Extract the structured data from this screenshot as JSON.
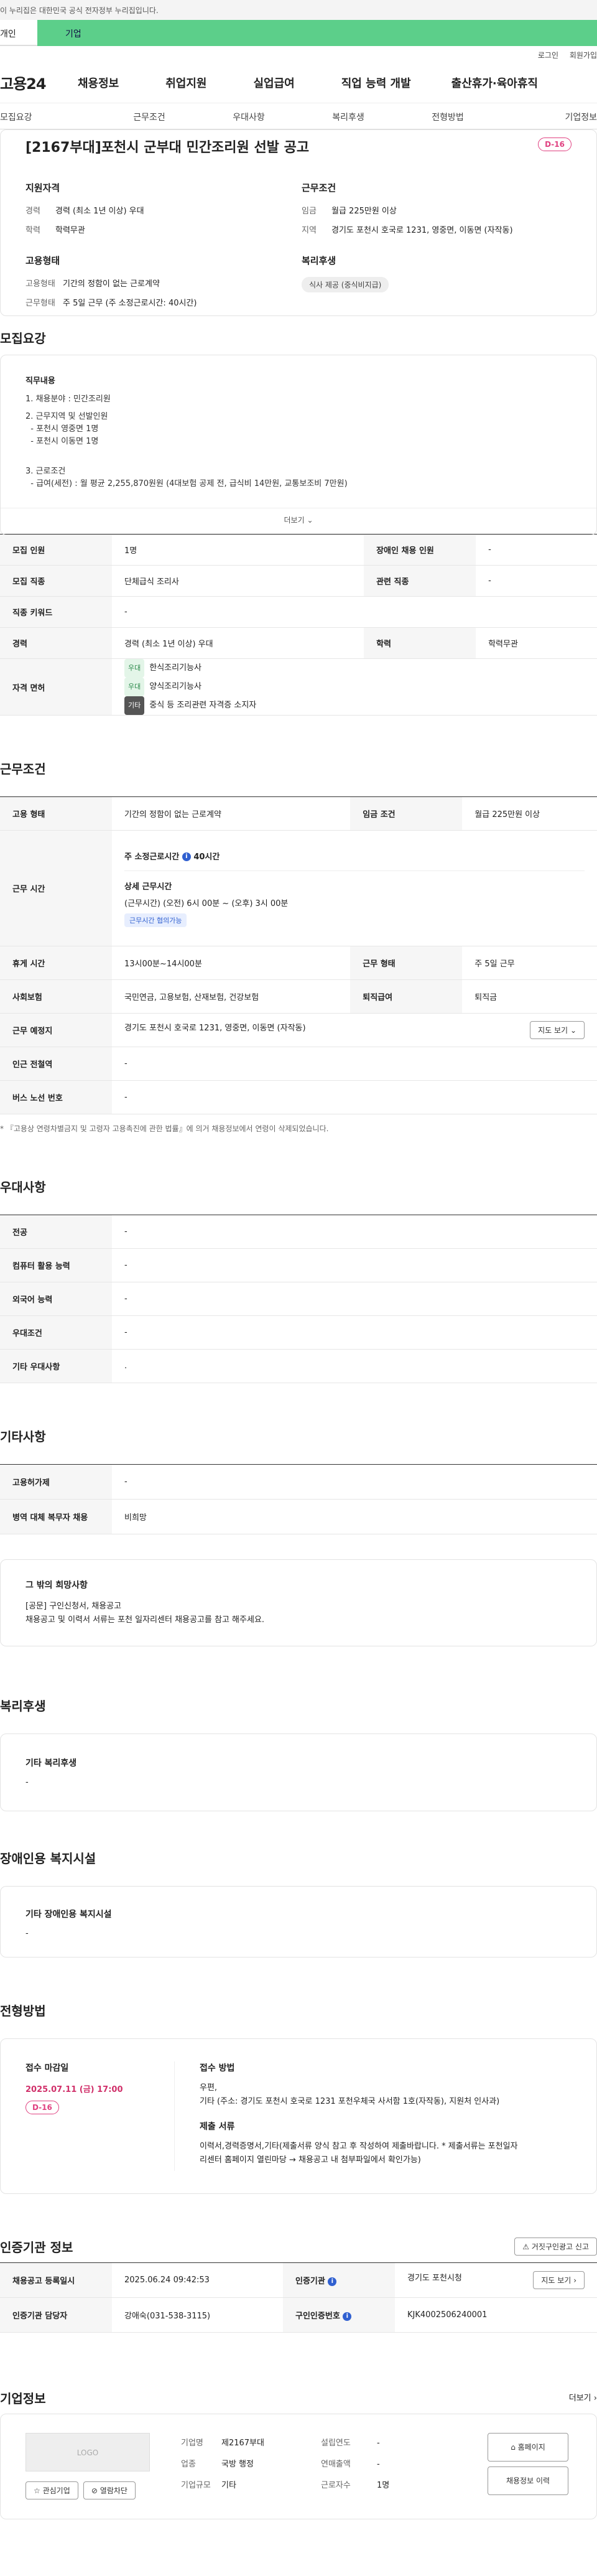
{
  "gov_banner": "이 누리집은 대한민국 공식 전자정부 누리집입니다.",
  "user_tabs": {
    "individual": "개인",
    "company": "기업"
  },
  "util_links": {
    "login": "로그인",
    "signup": "회원가입"
  },
  "logo": "고용24",
  "gnb": [
    "채용정보",
    "취업지원",
    "실업급여",
    "직업 능력 개발",
    "출산휴가·육아휴직"
  ],
  "subnav": [
    "모집요강",
    "근무조건",
    "우대사항",
    "복리후생",
    "전형방법",
    "기업정보"
  ],
  "title": {
    "heading": "[2167부대]포천시 군부대 민간조리원 선발 공고",
    "dday": "D-16",
    "qual_heading": "지원자격",
    "career_k": "경력",
    "career_v": "경력 (최소 1년 이상) 우대",
    "edu_k": "학력",
    "edu_v": "학력무관",
    "emp_heading": "고용형태",
    "emptype_k": "고용형태",
    "emptype_v": "기간의 정함이 없는 근로계약",
    "worktype_k": "근무형태",
    "worktype_v": "주 5일 근무 (주 소정근로시간: 40시간)",
    "cond_heading": "근무조건",
    "wage_k": "임금",
    "wage_v": "월급 225만원 이상",
    "area_k": "지역",
    "area_v": "경기도 포천시 호국로 1231, 영중면, 이동면 (자작동)",
    "welfare_heading": "복리후생",
    "welfare_pill": "식사 제공 (중식비지급)"
  },
  "recruit": {
    "heading": "모집요강",
    "duty_heading": "직무내용",
    "lines": [
      "1. 채용분야 : 민간조리원",
      "2. 근무지역 및 선발인원",
      "  - 포천시 영중면 1명",
      "  - 포천시 이동면 1명",
      "3. 근로조건",
      "  - 급여(세전) : 월 평균 2,255,870원원 (4대보험 공제 전, 급식비 14만원, 교통보조비 7만원)"
    ],
    "more": "더보기",
    "rows": {
      "count_k": "모집 인원",
      "count_v": "1명",
      "disabled_k": "장애인 채용 인원",
      "disabled_v": "-",
      "job_k": "모집 직종",
      "job_v": "단체급식 조리사",
      "related_k": "관련 직종",
      "related_v": "-",
      "keyword_k": "직종 키워드",
      "keyword_v": "-",
      "career_k": "경력",
      "career_v": "경력 (최소 1년 이상) 우대",
      "edu_k": "학력",
      "edu_v": "학력무관",
      "license_k": "자격 면허",
      "licenses": [
        {
          "tag": "우대",
          "name": "한식조리기능사"
        },
        {
          "tag": "우대",
          "name": "양식조리기능사"
        },
        {
          "tag": "기타",
          "name": "중식 등 조리관련 자격증 소지자"
        }
      ]
    }
  },
  "work": {
    "heading": "근무조건",
    "emp_k": "고용 형태",
    "emp_v": "기간의 정함이 없는 근로계약",
    "wage_k": "임금 조건",
    "wage_v": "월급 225만원 이상",
    "time_k": "근무 시간",
    "time_week": "주 소정근로시간",
    "time_hours": "40시간",
    "time_detail_h": "상세 근무시간",
    "time_detail_v": "(근무시간) (오전) 6시 00분 ~ (오후) 3시 00분",
    "time_tag": "근무시간 협의가능",
    "rest_k": "휴게 시간",
    "rest_v": "13시00분~14시00분",
    "form_k": "근무 형태",
    "form_v": "주 5일 근무",
    "ins_k": "사회보험",
    "ins_v": "국민연금, 고용보험, 산재보험, 건강보험",
    "sev_k": "퇴직급여",
    "sev_v": "퇴직금",
    "place_k": "근무 예정지",
    "place_v": "경기도 포천시 호국로 1231, 영중면, 이동면 (자작동)",
    "map_btn": "지도 보기",
    "station_k": "인근 전철역",
    "station_v": "-",
    "bus_k": "버스 노선 번호",
    "bus_v": "-",
    "note": "* 『고용상 연령차별금지 및 고령자 고용촉진에 관한 법률』에 의거 채용정보에서 연령이 삭제되었습니다."
  },
  "pref": {
    "heading": "우대사항",
    "rows": [
      {
        "k": "전공",
        "v": "-"
      },
      {
        "k": "컴퓨터 활용 능력",
        "v": "-"
      },
      {
        "k": "외국어 능력",
        "v": "-"
      },
      {
        "k": "우대조건",
        "v": "-"
      },
      {
        "k": "기타 우대사항",
        "v": "."
      }
    ]
  },
  "etc": {
    "heading": "기타사항",
    "rows": [
      {
        "k": "고용허가제",
        "v": "-"
      },
      {
        "k": "병역 대체 복무자 채용",
        "v": "비희망"
      }
    ],
    "hope_h": "그 밖의 희망사항",
    "hope_1": "[공문] 구인신청서, 채용공고",
    "hope_2": "채용공고 및 이력서 서류는 포천 일자리센터 채용공고를 참고 해주세요."
  },
  "welfare": {
    "heading": "복리후생",
    "box_h": "기타 복리후생",
    "box_v": "-"
  },
  "facility": {
    "heading": "장애인용 복지시설",
    "box_h": "기타 장애인용 복지시설",
    "box_v": "-"
  },
  "selection": {
    "heading": "전형방법",
    "deadline_h": "접수 마감일",
    "deadline_v": "2025.07.11 (금) 17:00",
    "dday": "D-16",
    "method_h": "접수 방법",
    "method_1": "우편,",
    "method_2": "기타 (주소: 경기도 포천시 호국로 1231 포천우체국 사서함 1호(자작동), 지원처 인사과)",
    "docs_h": "제출 서류",
    "docs_1": "이력서,경력증명서,기타(제출서류 양식 참고 후 작성하여 제출바랍니다. * 제출서류는 포천일자",
    "docs_2": "리센터 홈페이지 열린마당 → 채용공고 내 첨부파일에서 확인가능)"
  },
  "agency": {
    "heading": "인증기관 정보",
    "report_btn": "거짓구인광고 신고",
    "reg_k": "채용공고 등록일시",
    "reg_v": "2025.06.24 09:42:53",
    "org_k": "인증기관",
    "org_v": "경기도 포천시청",
    "map_btn": "지도 보기",
    "mgr_k": "인증기관 담당자",
    "mgr_v": "강애숙(031-538-3115)",
    "no_k": "구인인증번호",
    "no_v": "KJK4002506240001"
  },
  "company": {
    "heading": "기업정보",
    "more": "더보기",
    "logo": "LOGO",
    "fav_btn": "관심기업",
    "block_btn": "열람차단",
    "name_k": "기업명",
    "name_v": "제2167부대",
    "year_k": "설립연도",
    "year_v": "-",
    "ind_k": "업종",
    "ind_v": "국방 행정",
    "sales_k": "연매출액",
    "sales_v": "-",
    "size_k": "기업규모",
    "size_v": "기타",
    "emp_k": "근로자수",
    "emp_v": "1명",
    "home_btn": "홈페이지",
    "history_btn": "채용정보 이력"
  }
}
